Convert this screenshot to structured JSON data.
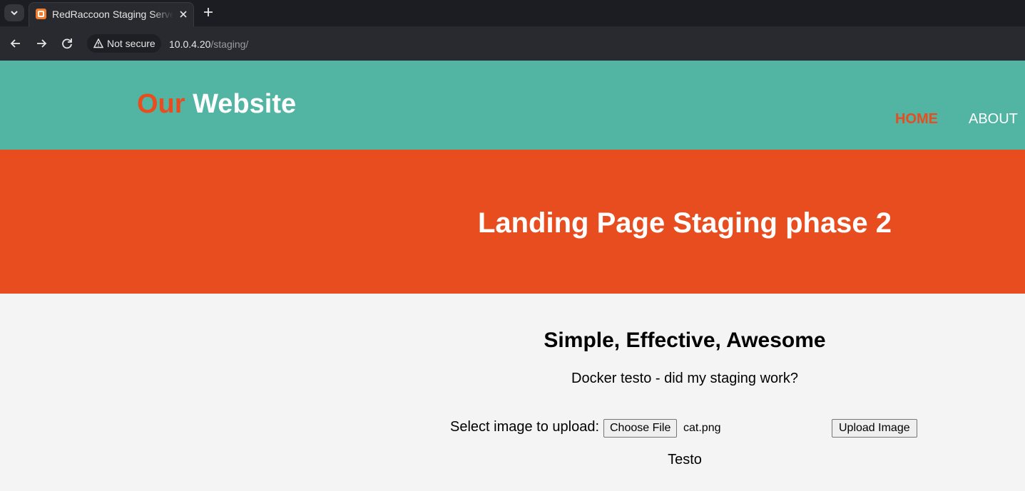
{
  "browser": {
    "tab": {
      "title": "RedRaccoon Staging Server",
      "favicon": "xampp-icon"
    },
    "address": {
      "security_label": "Not secure",
      "host": "10.0.4.20",
      "path": "/staging/"
    }
  },
  "site": {
    "logo": {
      "accent": "Our",
      "rest": " Website"
    },
    "nav": {
      "home": "HOME",
      "about": "ABOUT"
    },
    "hero_title": "Landing Page Staging phase 2",
    "section_title": "Simple, Effective, Awesome",
    "tagline": "Docker testo - did my staging work?",
    "upload": {
      "label": "Select image to upload:",
      "choose_file": "Choose File",
      "file_name": "cat.png",
      "submit": "Upload Image"
    },
    "footer_text": "Testo"
  },
  "colors": {
    "header_bg": "#52b4a3",
    "accent": "#e84d1f",
    "page_bg": "#f4f4f4"
  }
}
